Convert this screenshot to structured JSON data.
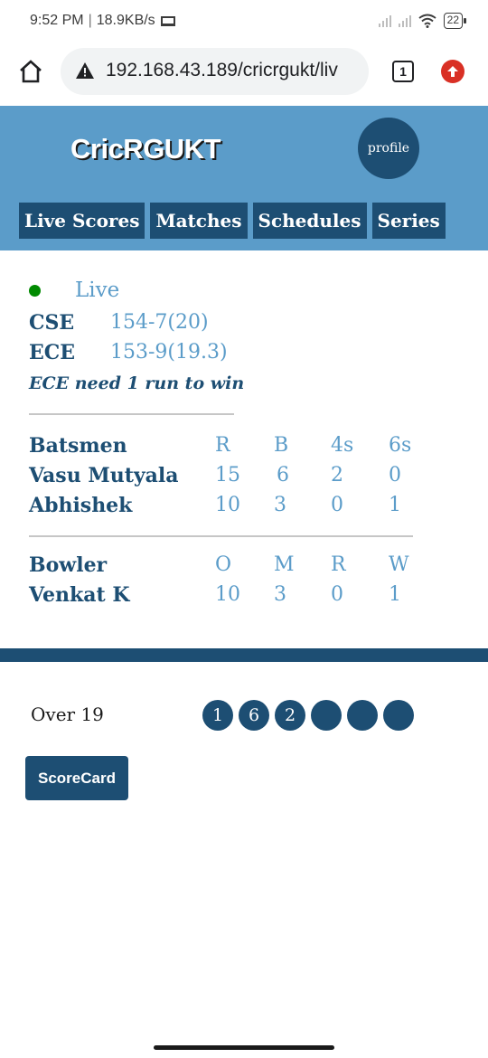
{
  "status_bar": {
    "time": "9:52 PM",
    "speed": "18.9KB/s",
    "battery": "22"
  },
  "browser": {
    "url": "192.168.43.189/cricrgukt/liv",
    "tab_count": "1"
  },
  "header": {
    "brand": "CricRGUKT",
    "profile_label": "profile",
    "nav": [
      "Live Scores",
      "Matches",
      "Schedules",
      "Series"
    ]
  },
  "match": {
    "status": "Live",
    "teams": [
      {
        "name": "CSE",
        "score": "154-7(20)"
      },
      {
        "name": "ECE",
        "score": "153-9(19.3)"
      }
    ],
    "need_text": "ECE need 1 run to win"
  },
  "batting": {
    "headers": [
      "Batsmen",
      "R",
      "B",
      "4s",
      "6s"
    ],
    "rows": [
      [
        "Vasu Mutyala",
        "15",
        "6",
        "2",
        "0"
      ],
      [
        "Abhishek",
        "10",
        "3",
        "0",
        "1"
      ]
    ]
  },
  "bowling": {
    "headers": [
      "Bowler",
      "O",
      "M",
      "R",
      "W"
    ],
    "rows": [
      [
        "Venkat K",
        "10",
        "3",
        "0",
        "1"
      ]
    ]
  },
  "over": {
    "label": "Over 19",
    "balls": [
      "1",
      "6",
      "2",
      "",
      "",
      ""
    ]
  },
  "scorecard_label": "ScoreCard",
  "colors": {
    "primary": "#1d4e73",
    "header_bg": "#5b9cc9",
    "accent_text": "#5b9cc9",
    "live_dot": "#008a00"
  }
}
